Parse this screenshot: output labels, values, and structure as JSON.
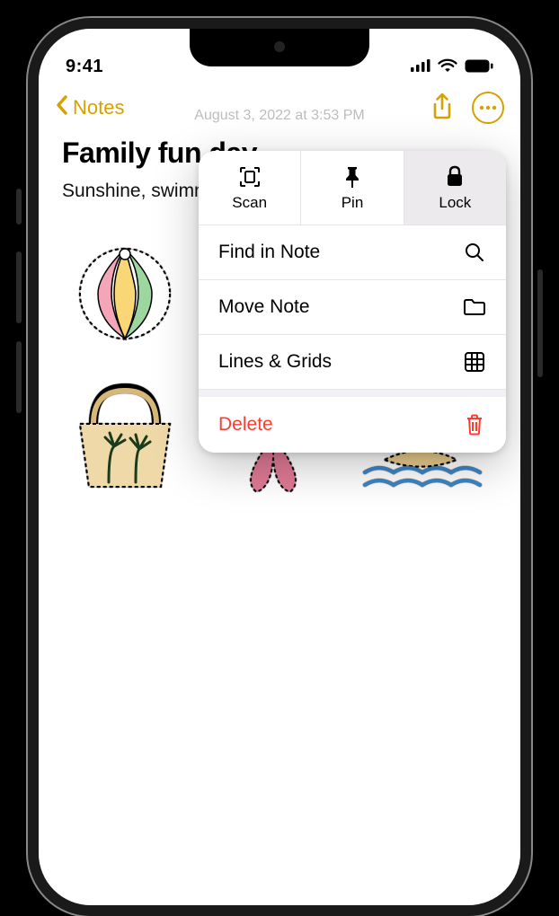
{
  "status": {
    "time": "9:41"
  },
  "nav": {
    "back_label": "Notes"
  },
  "note": {
    "meta": "August 3, 2022 at 3:53 PM",
    "title": "Family fun day",
    "body": "Sunshine, swimming, cold drinks, and music!"
  },
  "popover": {
    "top": {
      "scan": "Scan",
      "pin": "Pin",
      "lock": "Lock"
    },
    "items": {
      "find": "Find in Note",
      "move": "Move Note",
      "lines": "Lines & Grids",
      "delete": "Delete"
    }
  }
}
